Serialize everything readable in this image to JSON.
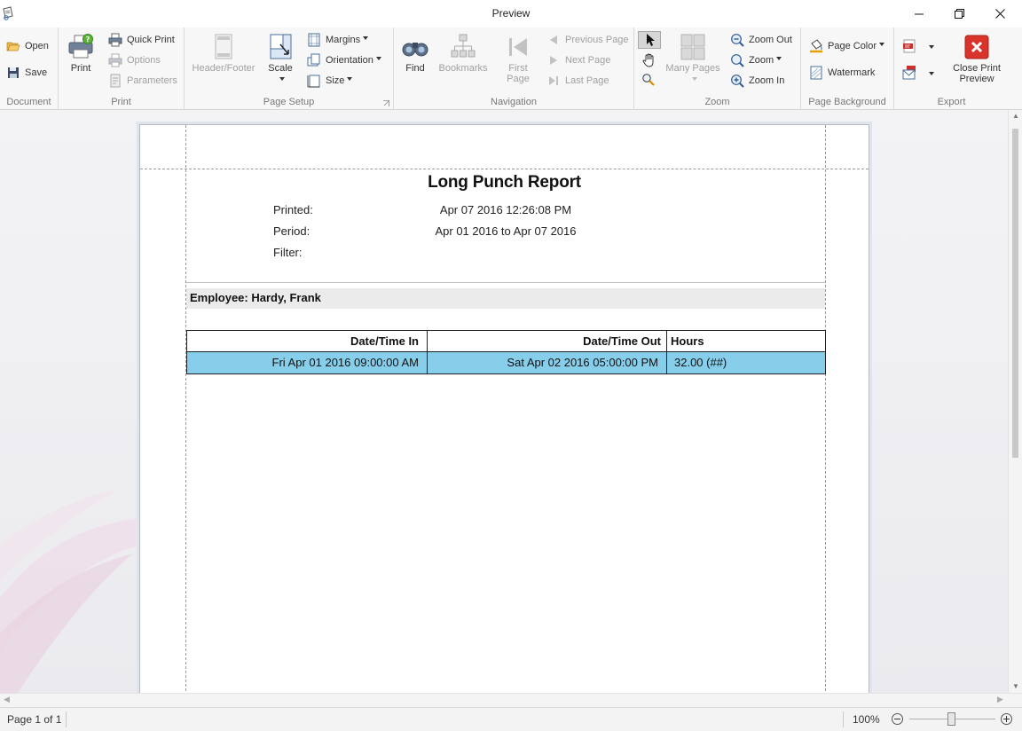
{
  "window": {
    "title": "Preview"
  },
  "ribbon": {
    "document": {
      "label": "Document",
      "open": "Open",
      "save": "Save"
    },
    "print": {
      "label": "Print",
      "print": "Print",
      "quick_print": "Quick Print",
      "options": "Options",
      "parameters": "Parameters"
    },
    "page_setup": {
      "label": "Page Setup",
      "header_footer": "Header/Footer",
      "scale": "Scale",
      "margins": "Margins",
      "orientation": "Orientation",
      "size": "Size"
    },
    "navigation": {
      "label": "Navigation",
      "find": "Find",
      "bookmarks": "Bookmarks",
      "first_page_1": "First",
      "first_page_2": "Page",
      "previous_page": "Previous Page",
      "next_page": "Next Page",
      "last_page": "Last Page"
    },
    "zoom": {
      "label": "Zoom",
      "many_pages": "Many Pages",
      "zoom_out": "Zoom Out",
      "zoom": "Zoom",
      "zoom_in": "Zoom In"
    },
    "page_background": {
      "label": "Page Background",
      "page_color": "Page Color",
      "watermark": "Watermark"
    },
    "export": {
      "label": "Export",
      "close_preview_1": "Close Print",
      "close_preview_2": "Preview"
    }
  },
  "report": {
    "title": "Long Punch Report",
    "printed_label": "Printed:",
    "printed_value": "Apr 07 2016 12:26:08 PM",
    "period_label": "Period:",
    "period_value": "Apr 01 2016 to Apr 07 2016",
    "filter_label": "Filter:",
    "employee": "Employee: Hardy, Frank",
    "columns": [
      "Date/Time In",
      "Date/Time Out",
      "Hours"
    ],
    "rows": [
      {
        "in": "Fri Apr 01 2016 09:00:00 AM",
        "out": "Sat Apr 02 2016 05:00:00 PM",
        "hours": "32.00 (##)"
      }
    ],
    "highlight_color": "#87CEEB"
  },
  "status": {
    "page_info": "Page 1 of 1",
    "zoom_percent": "100%",
    "zoom_level": 1.0
  }
}
